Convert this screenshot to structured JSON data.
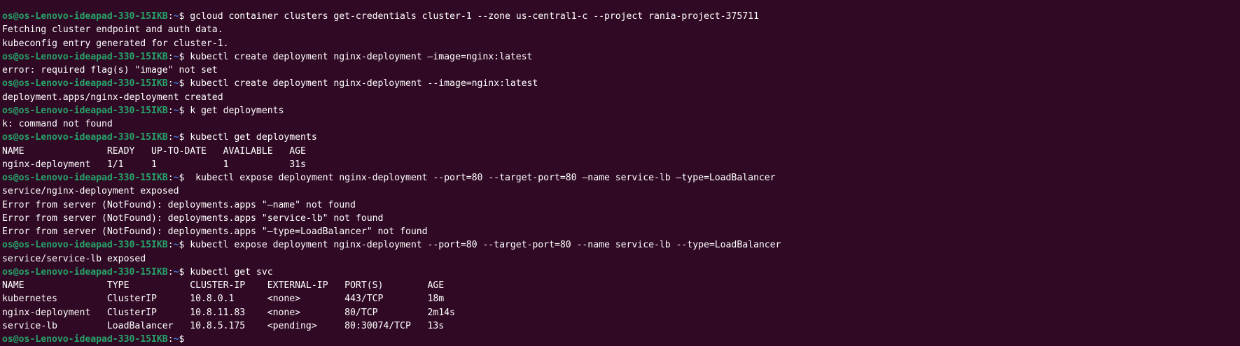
{
  "prompt": {
    "user_host": "os@os-Lenovo-ideapad-330-15IKB",
    "colon": ":",
    "path": "~",
    "symbol": "$ "
  },
  "colors": {
    "background": "#300a24",
    "user": "#26a269",
    "path": "#3d7cd9",
    "text": "#ffffff"
  },
  "lines": [
    {
      "type": "cmd",
      "text": "gcloud container clusters get-credentials cluster-1 --zone us-central1-c --project rania-project-375711"
    },
    {
      "type": "out",
      "text": "Fetching cluster endpoint and auth data."
    },
    {
      "type": "out",
      "text": "kubeconfig entry generated for cluster-1."
    },
    {
      "type": "cmd",
      "text": "kubectl create deployment nginx-deployment –image=nginx:latest"
    },
    {
      "type": "out",
      "text": "error: required flag(s) \"image\" not set"
    },
    {
      "type": "cmd",
      "text": "kubectl create deployment nginx-deployment --image=nginx:latest"
    },
    {
      "type": "out",
      "text": "deployment.apps/nginx-deployment created"
    },
    {
      "type": "cmd",
      "text": "k get deployments"
    },
    {
      "type": "out",
      "text": "k: command not found"
    },
    {
      "type": "cmd",
      "text": "kubectl get deployments"
    },
    {
      "type": "out",
      "text": "NAME               READY   UP-TO-DATE   AVAILABLE   AGE"
    },
    {
      "type": "out",
      "text": "nginx-deployment   1/1     1            1           31s"
    },
    {
      "type": "cmd",
      "text": " kubectl expose deployment nginx-deployment --port=80 --target-port=80 –name service-lb –type=LoadBalancer"
    },
    {
      "type": "out",
      "text": "service/nginx-deployment exposed"
    },
    {
      "type": "out",
      "text": "Error from server (NotFound): deployments.apps \"–name\" not found"
    },
    {
      "type": "out",
      "text": "Error from server (NotFound): deployments.apps \"service-lb\" not found"
    },
    {
      "type": "out",
      "text": "Error from server (NotFound): deployments.apps \"–type=LoadBalancer\" not found"
    },
    {
      "type": "cmd",
      "text": "kubectl expose deployment nginx-deployment --port=80 --target-port=80 --name service-lb --type=LoadBalancer"
    },
    {
      "type": "out",
      "text": "service/service-lb exposed"
    },
    {
      "type": "cmd",
      "text": "kubectl get svc"
    },
    {
      "type": "out",
      "text": "NAME               TYPE           CLUSTER-IP    EXTERNAL-IP   PORT(S)        AGE"
    },
    {
      "type": "out",
      "text": "kubernetes         ClusterIP      10.8.0.1      <none>        443/TCP        18m"
    },
    {
      "type": "out",
      "text": "nginx-deployment   ClusterIP      10.8.11.83    <none>        80/TCP         2m14s"
    },
    {
      "type": "out",
      "text": "service-lb         LoadBalancer   10.8.5.175    <pending>     80:30074/TCP   13s"
    },
    {
      "type": "cmd",
      "text": ""
    }
  ]
}
